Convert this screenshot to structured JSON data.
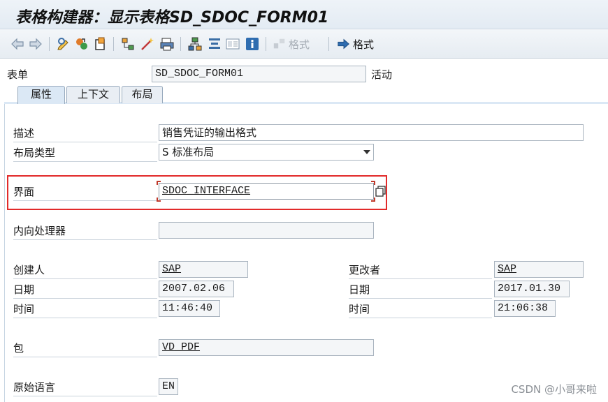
{
  "window": {
    "title": "表格构建器：显示表格SD_SDOC_FORM01"
  },
  "toolbar": {
    "buttons": [
      "back-arrow-icon",
      "forward-arrow-icon",
      "display-change-icon",
      "check-icon",
      "activate-icon",
      "hierarchy-icon",
      "wand-icon",
      "print-icon",
      "structure-icon",
      "align-icon",
      "layout-icon",
      "info-icon"
    ],
    "format_disabled_label": "格式",
    "format_label": "格式"
  },
  "header": {
    "form_label": "表单",
    "form_value": "SD_SDOC_FORM01",
    "status": "活动"
  },
  "tabs": [
    {
      "label": "属性",
      "active": true
    },
    {
      "label": "上下文",
      "active": false
    },
    {
      "label": "布局",
      "active": false
    }
  ],
  "attributes": {
    "description_label": "描述",
    "description_value": "销售凭证的输出格式",
    "layout_type_label": "布局类型",
    "layout_type_value": "S 标准布局",
    "interface_label": "界面",
    "interface_value": "SDOC_INTERFACE",
    "inbound_label": "内向处理器",
    "inbound_value": "",
    "created_by_label": "创建人",
    "created_by_value": "SAP",
    "created_date_label": "日期",
    "created_date_value": "2007.02.06",
    "created_time_label": "时间",
    "created_time_value": "11:46:40",
    "changed_by_label": "更改者",
    "changed_by_value": "SAP",
    "changed_date_label": "日期",
    "changed_date_value": "2017.01.30",
    "changed_time_label": "时间",
    "changed_time_value": "21:06:38",
    "package_label": "包",
    "package_value": "VD_PDF",
    "language_label": "原始语言",
    "language_value": "EN"
  },
  "watermark": "CSDN @小哥来啦",
  "colors": {
    "highlight": "#e22a2a",
    "tab_active": "#dbe8f5",
    "titlebar": "#e3ebf3"
  }
}
